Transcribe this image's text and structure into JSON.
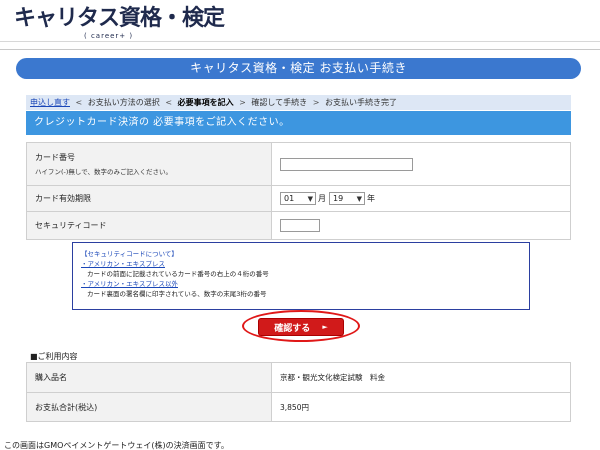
{
  "header": {
    "logo_text": "キャリタス資格・検定",
    "logo_sub": "( career+ )"
  },
  "title_bar": {
    "text": "キャリタス資格・検定 お支払い手続き"
  },
  "breadcrumb": {
    "back_link": "申込し直す",
    "step1": "お支払い方法の選択",
    "step2": "必要事項を記入",
    "step3": "確認して手続き",
    "step4": "お支払い手続き完了"
  },
  "section_head": {
    "text": "クレジットカード決済の 必要事項をご記入ください。"
  },
  "form": {
    "card_number_label": "カード番号",
    "card_number_note": "ハイフン(-)無しで、数字のみご記入ください。",
    "card_number_value": "",
    "expiry_label": "カード有効期限",
    "expiry_month": "01",
    "month_unit": "月",
    "expiry_year": "19",
    "year_unit": "年",
    "security_label": "セキュリティコード",
    "security_value": ""
  },
  "security_info": {
    "title": "【セキュリティコードについて】",
    "amex_link": "・アメリカン・エキスプレス",
    "amex_desc": "カードの前面に記載されているカード番号の右上の４桁の番号",
    "other_link": "・アメリカン・エキスプレス以外",
    "other_desc": "カード裏面の署名欄に印字されている、数字の末尾3桁の番号"
  },
  "confirm_button": {
    "label": "確認する"
  },
  "usage": {
    "heading": "■ご利用内容",
    "product_label": "購入品名",
    "product_value": "京都・観光文化検定試験　料金",
    "total_label": "お支払合計(税込)",
    "total_value": "3,850円"
  },
  "footer": {
    "note": "この画面はGMOペイメントゲートウェイ(株)の決済画面です。"
  },
  "colors": {
    "title_bar": "#3b78cf",
    "section_head": "#3d96e0",
    "confirm_button": "#d11a1a",
    "highlight_ring": "#e01818"
  }
}
